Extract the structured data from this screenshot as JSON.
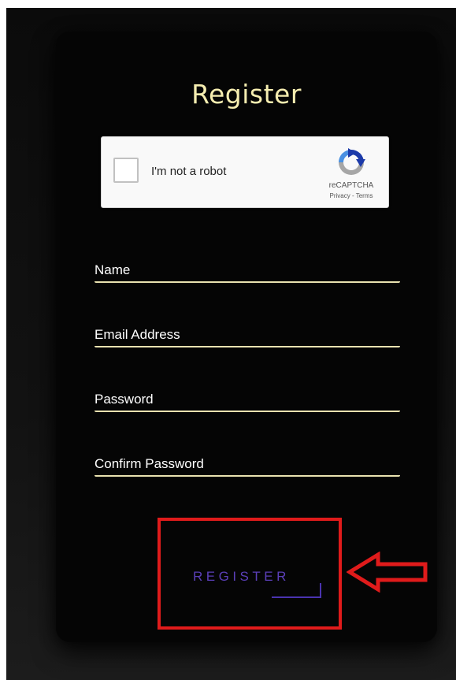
{
  "form": {
    "title": "Register",
    "fields": [
      {
        "label": "Name"
      },
      {
        "label": "Email Address"
      },
      {
        "label": "Password"
      },
      {
        "label": "Confirm Password"
      }
    ],
    "submit_label": "REGISTER"
  },
  "recaptcha": {
    "label": "I'm not a robot",
    "brand": "reCAPTCHA",
    "privacy": "Privacy",
    "separator": "-",
    "terms": "Terms",
    "icon": "recaptcha-logo-icon"
  },
  "annotation": {
    "highlight_color": "#e01b1b",
    "arrow_icon": "left-arrow-icon"
  },
  "colors": {
    "title": "#f5edb0",
    "underline": "#e9e2b0",
    "button_text": "#5b3fb8",
    "background": "#050505"
  }
}
